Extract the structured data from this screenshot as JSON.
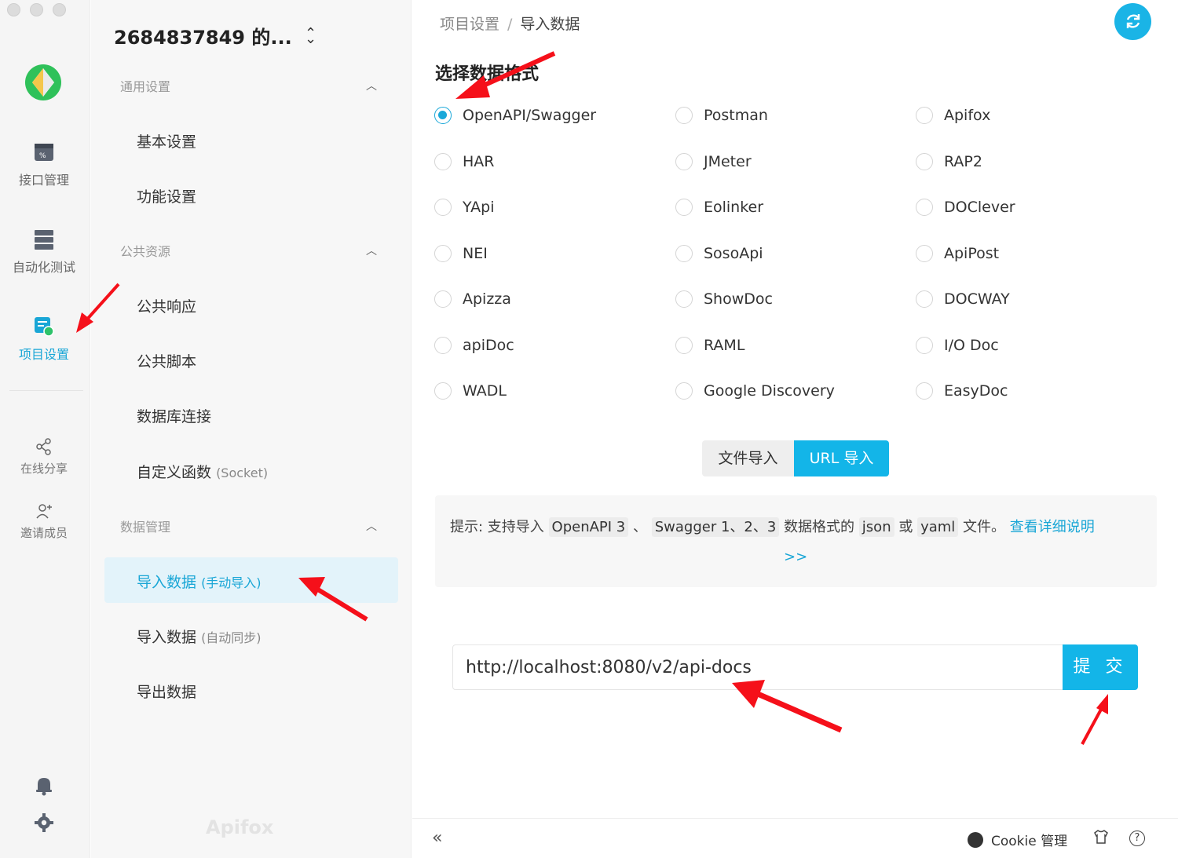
{
  "rail": {
    "items": [
      {
        "label": "接口管理",
        "icon": "api-icon"
      },
      {
        "label": "自动化测试",
        "icon": "test-icon"
      },
      {
        "label": "项目设置",
        "icon": "settings-project-icon"
      },
      {
        "label": "在线分享",
        "icon": "share-icon"
      },
      {
        "label": "邀请成员",
        "icon": "invite-icon"
      }
    ]
  },
  "sidebar": {
    "project_title": "2684837849 的...",
    "groups": [
      {
        "label": "通用设置",
        "items": [
          "基本设置",
          "功能设置"
        ]
      },
      {
        "label": "公共资源",
        "items": [
          "公共响应",
          "公共脚本",
          "数据库连接",
          "自定义函数"
        ]
      },
      {
        "label": "数据管理",
        "items": [
          "导入数据",
          "导入数据",
          "导出数据"
        ]
      }
    ],
    "custom_func_suffix": "(Socket)",
    "import_manual_suffix": "(手动导入)",
    "import_auto_suffix": "(自动同步)",
    "watermark": "Apifox"
  },
  "main": {
    "breadcrumb": {
      "parent": "项目设置",
      "sep": "/",
      "current": "导入数据"
    },
    "section_title": "选择数据格式",
    "formats": [
      "OpenAPI/Swagger",
      "Postman",
      "Apifox",
      "HAR",
      "JMeter",
      "RAP2",
      "YApi",
      "Eolinker",
      "DOClever",
      "NEI",
      "SosoApi",
      "ApiPost",
      "Apizza",
      "ShowDoc",
      "DOCWAY",
      "apiDoc",
      "RAML",
      "I/O Doc",
      "WADL",
      "Google Discovery",
      "EasyDoc"
    ],
    "selected_format": "OpenAPI/Swagger",
    "import_tabs": {
      "file": "文件导入",
      "url": "URL 导入",
      "active": "URL 导入"
    },
    "tip": {
      "prefix": "提示: 支持导入",
      "code1": "OpenAPI 3",
      "sep1": "、",
      "code2": "Swagger 1、2、3",
      "mid": "数据格式的",
      "code3": "json",
      "or": "或",
      "code4": "yaml",
      "suffix": "文件。",
      "link": "查看详细说明",
      "more": ">>"
    },
    "url_value": "http://localhost:8080/v2/api-docs",
    "submit_label": "提 交"
  },
  "footer": {
    "collapse": "«",
    "cookie_label": "Cookie 管理",
    "help": "?"
  },
  "colors": {
    "accent": "#13b5e8",
    "annotation": "#f5101a"
  }
}
